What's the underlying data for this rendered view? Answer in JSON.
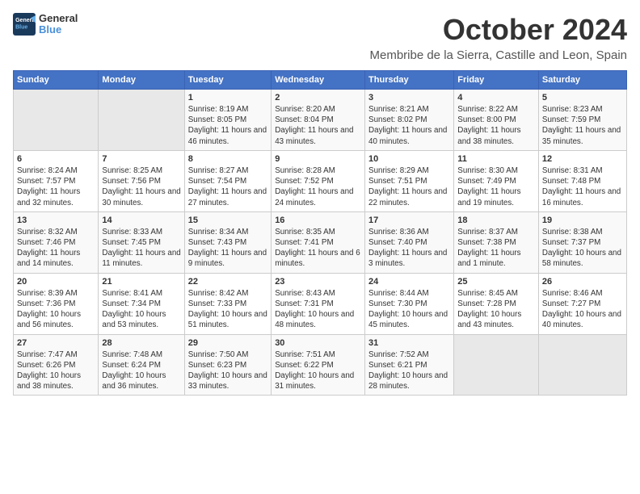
{
  "header": {
    "logo_line1": "General",
    "logo_line2": "Blue",
    "title": "October 2024",
    "subtitle": "Membribe de la Sierra, Castille and Leon, Spain"
  },
  "days_of_week": [
    "Sunday",
    "Monday",
    "Tuesday",
    "Wednesday",
    "Thursday",
    "Friday",
    "Saturday"
  ],
  "weeks": [
    {
      "days": [
        {
          "num": "",
          "info": "",
          "empty": true
        },
        {
          "num": "",
          "info": "",
          "empty": true
        },
        {
          "num": "1",
          "info": "Sunrise: 8:19 AM\nSunset: 8:05 PM\nDaylight: 11 hours and 46 minutes."
        },
        {
          "num": "2",
          "info": "Sunrise: 8:20 AM\nSunset: 8:04 PM\nDaylight: 11 hours and 43 minutes."
        },
        {
          "num": "3",
          "info": "Sunrise: 8:21 AM\nSunset: 8:02 PM\nDaylight: 11 hours and 40 minutes."
        },
        {
          "num": "4",
          "info": "Sunrise: 8:22 AM\nSunset: 8:00 PM\nDaylight: 11 hours and 38 minutes."
        },
        {
          "num": "5",
          "info": "Sunrise: 8:23 AM\nSunset: 7:59 PM\nDaylight: 11 hours and 35 minutes."
        }
      ]
    },
    {
      "days": [
        {
          "num": "6",
          "info": "Sunrise: 8:24 AM\nSunset: 7:57 PM\nDaylight: 11 hours and 32 minutes."
        },
        {
          "num": "7",
          "info": "Sunrise: 8:25 AM\nSunset: 7:56 PM\nDaylight: 11 hours and 30 minutes."
        },
        {
          "num": "8",
          "info": "Sunrise: 8:27 AM\nSunset: 7:54 PM\nDaylight: 11 hours and 27 minutes."
        },
        {
          "num": "9",
          "info": "Sunrise: 8:28 AM\nSunset: 7:52 PM\nDaylight: 11 hours and 24 minutes."
        },
        {
          "num": "10",
          "info": "Sunrise: 8:29 AM\nSunset: 7:51 PM\nDaylight: 11 hours and 22 minutes."
        },
        {
          "num": "11",
          "info": "Sunrise: 8:30 AM\nSunset: 7:49 PM\nDaylight: 11 hours and 19 minutes."
        },
        {
          "num": "12",
          "info": "Sunrise: 8:31 AM\nSunset: 7:48 PM\nDaylight: 11 hours and 16 minutes."
        }
      ]
    },
    {
      "days": [
        {
          "num": "13",
          "info": "Sunrise: 8:32 AM\nSunset: 7:46 PM\nDaylight: 11 hours and 14 minutes."
        },
        {
          "num": "14",
          "info": "Sunrise: 8:33 AM\nSunset: 7:45 PM\nDaylight: 11 hours and 11 minutes."
        },
        {
          "num": "15",
          "info": "Sunrise: 8:34 AM\nSunset: 7:43 PM\nDaylight: 11 hours and 9 minutes."
        },
        {
          "num": "16",
          "info": "Sunrise: 8:35 AM\nSunset: 7:41 PM\nDaylight: 11 hours and 6 minutes."
        },
        {
          "num": "17",
          "info": "Sunrise: 8:36 AM\nSunset: 7:40 PM\nDaylight: 11 hours and 3 minutes."
        },
        {
          "num": "18",
          "info": "Sunrise: 8:37 AM\nSunset: 7:38 PM\nDaylight: 11 hours and 1 minute."
        },
        {
          "num": "19",
          "info": "Sunrise: 8:38 AM\nSunset: 7:37 PM\nDaylight: 10 hours and 58 minutes."
        }
      ]
    },
    {
      "days": [
        {
          "num": "20",
          "info": "Sunrise: 8:39 AM\nSunset: 7:36 PM\nDaylight: 10 hours and 56 minutes."
        },
        {
          "num": "21",
          "info": "Sunrise: 8:41 AM\nSunset: 7:34 PM\nDaylight: 10 hours and 53 minutes."
        },
        {
          "num": "22",
          "info": "Sunrise: 8:42 AM\nSunset: 7:33 PM\nDaylight: 10 hours and 51 minutes."
        },
        {
          "num": "23",
          "info": "Sunrise: 8:43 AM\nSunset: 7:31 PM\nDaylight: 10 hours and 48 minutes."
        },
        {
          "num": "24",
          "info": "Sunrise: 8:44 AM\nSunset: 7:30 PM\nDaylight: 10 hours and 45 minutes."
        },
        {
          "num": "25",
          "info": "Sunrise: 8:45 AM\nSunset: 7:28 PM\nDaylight: 10 hours and 43 minutes."
        },
        {
          "num": "26",
          "info": "Sunrise: 8:46 AM\nSunset: 7:27 PM\nDaylight: 10 hours and 40 minutes."
        }
      ]
    },
    {
      "days": [
        {
          "num": "27",
          "info": "Sunrise: 7:47 AM\nSunset: 6:26 PM\nDaylight: 10 hours and 38 minutes."
        },
        {
          "num": "28",
          "info": "Sunrise: 7:48 AM\nSunset: 6:24 PM\nDaylight: 10 hours and 36 minutes."
        },
        {
          "num": "29",
          "info": "Sunrise: 7:50 AM\nSunset: 6:23 PM\nDaylight: 10 hours and 33 minutes."
        },
        {
          "num": "30",
          "info": "Sunrise: 7:51 AM\nSunset: 6:22 PM\nDaylight: 10 hours and 31 minutes."
        },
        {
          "num": "31",
          "info": "Sunrise: 7:52 AM\nSunset: 6:21 PM\nDaylight: 10 hours and 28 minutes."
        },
        {
          "num": "",
          "info": "",
          "empty": true
        },
        {
          "num": "",
          "info": "",
          "empty": true
        }
      ]
    }
  ]
}
